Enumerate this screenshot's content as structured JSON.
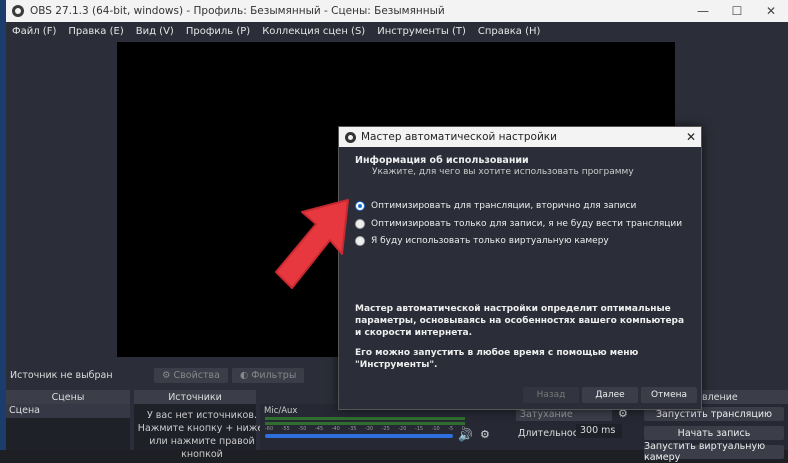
{
  "window": {
    "title": "OBS 27.1.3 (64-bit, windows) - Профиль: Безымянный - Сцены: Безымянный"
  },
  "menu": [
    "Файл (F)",
    "Правка (E)",
    "Вид (V)",
    "Профиль (P)",
    "Коллекция сцен (S)",
    "Инструменты (T)",
    "Справка (H)"
  ],
  "sourcebar": {
    "status": "Источник не выбран",
    "properties": "Свойства",
    "filters": "Фильтры"
  },
  "docks": {
    "scenes": "Сцены",
    "sources": "Источники",
    "controls": "вление"
  },
  "scenes": [
    "Сцена"
  ],
  "sources_empty": [
    "У вас нет источников.",
    "Нажмите кнопку + ниже,",
    "или нажмите правой кнопкой"
  ],
  "mixer": {
    "track": "Mic/Aux",
    "ticks": [
      "-60",
      "-55",
      "-50",
      "-45",
      "-40",
      "-35",
      "-30",
      "-25",
      "-20",
      "-15",
      "-10",
      "-5",
      "0"
    ]
  },
  "transitions": {
    "fade": "Затухание",
    "duration_label": "Длительность",
    "duration_value": "300 ms"
  },
  "controls": {
    "stream": "Запустить трансляцию",
    "record": "Начать запись",
    "virtual": "Запустить виртуальную камеру"
  },
  "dialog": {
    "title": "Мастер автоматической настройки",
    "heading": "Информация об использовании",
    "subheading": "Укажите, для чего вы хотите использовать программу",
    "options": [
      "Оптимизировать для трансляции, вторично для записи",
      "Оптимизировать только для записи, я не буду вести трансляции",
      "Я буду использовать только виртуальную камеру"
    ],
    "selected_option": 0,
    "info1": "Мастер автоматической настройки определит оптимальные параметры, основываясь на особенностях вашего компьютера и скорости интернета.",
    "info2": "Его можно запустить в любое время с помощью меню \"Инструменты\".",
    "back": "Назад",
    "next": "Далее",
    "cancel": "Отмена"
  }
}
